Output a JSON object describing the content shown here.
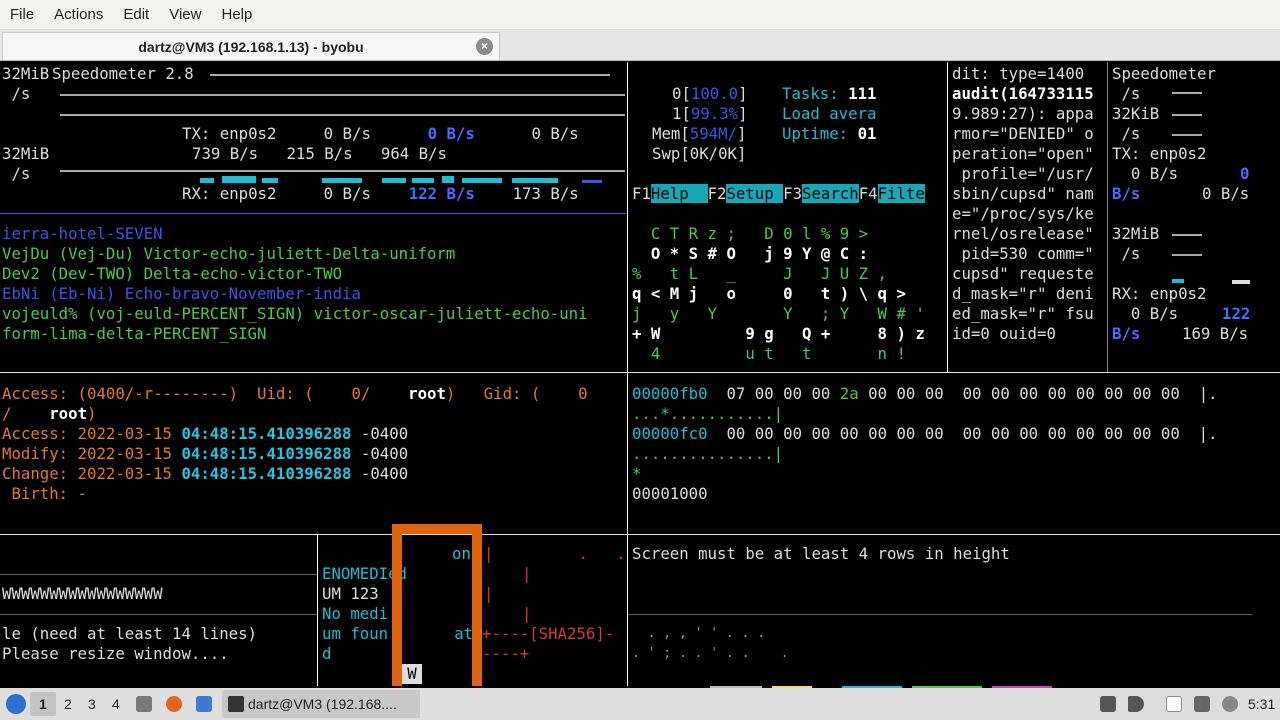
{
  "menubar": {
    "items": [
      "File",
      "Actions",
      "Edit",
      "View",
      "Help"
    ]
  },
  "tab": {
    "title": "dartz@VM3 (192.168.1.13) - byobu",
    "close": "×"
  },
  "speedometer": {
    "l1a": "32MiB",
    "l1b": "Speedometer 2.8",
    "l2": " /s",
    "tx": "TX: enp0s2     0 B/s      ",
    "tx_v": "0 B/s",
    "tx_t": "      0 B/s",
    "l5a": "32MiB",
    "l5b": "739 B/s   215 B/s   964 B/s",
    "l6": " /s",
    "rx": "RX: enp0s2     0 B/s    ",
    "rx_v": "122 B/s",
    "rx_t": "    173 B/s"
  },
  "htop": {
    "c0": "0[",
    "c0v": "100.0",
    "c0e": "]",
    "c1": "1[",
    "c1v": "99.3%",
    "c1e": "]",
    "mem": "Mem[",
    "memv": "594M/",
    "meme": "]",
    "swp": "Swp[0K/0K]",
    "tasks_l": "Tasks: ",
    "tasks_v": "111",
    "load": "Load avera",
    "up_l": "Uptime: ",
    "up_v": "01",
    "f1": "F1",
    "f1l": "Help  ",
    "f2": "F2",
    "f2l": "Setup ",
    "f3": "F3",
    "f3l": "Search",
    "f4": "F4",
    "f4l": "Filte"
  },
  "audit": {
    "a1": "dit: type=1400",
    "a2": "audit(164733115",
    "a3": "9.989:27): appa",
    "a4": "rmor=\"DENIED\" o",
    "a5": "peration=\"open\"",
    "a6": " profile=\"/usr/",
    "a7": "sbin/cupsd\" nam",
    "a8": "e=\"/proc/sys/ke",
    "a9": "rnel/osrelease\"",
    "a10": " pid=530 comm=\"",
    "a11": "cupsd\" requeste",
    "a12": "d_mask=\"r\" deni",
    "a13": "ed_mask=\"r\" fsu",
    "a14": "id=0 ouid=0"
  },
  "speed2": {
    "s1": "Speedometer",
    "s2": " /s",
    "s3": "32KiB",
    "s4": " /s",
    "s5": "TX: enp0s2",
    "s6a": "  0 B/s",
    "s6b": "0",
    "s7a": "B/s",
    "s7b": "0 B/s",
    "s8": "32MiB",
    "s9": " /s",
    "s10": "RX: enp0s2",
    "s11a": "  0 B/s",
    "s11b": "122",
    "s12a": "B/s",
    "s12b": "169 B/s"
  },
  "words": {
    "w1": "ierra-hotel-SEVEN",
    "w2": "VejDu (Vej-Du) Victor-echo-juliett-Delta-uniform",
    "w3": "Dev2 (Dev-TWO) Delta-echo-victor-TWO",
    "w4": "EbNi (Eb-Ni) Echo-bravo-November-india",
    "w5": "vojeuld% (voj-euld-PERCENT_SIGN) victor-oscar-juliett-echo-uni",
    "w6": "form-lima-delta-PERCENT_SIGN"
  },
  "matrix": {
    "m1": "  C T R z ;   D 0 l % 9 >",
    "m2": "  O * S # O   j 9 Y @ C :",
    "m3": "%   t L   _     J   J U Z ,",
    "m4": "q < M j   o     0   t ) \\ q >",
    "m5": "j   y   Y       Y   ; Y   W # '",
    "m6": "+ W         9 g   Q +     8 ) z",
    "m7": "  4         u t   t       n !"
  },
  "stat": {
    "p1a": "Access: (0400/-r--------)  Uid: (    0/    ",
    "p1b": "root",
    "p1c": ")   Gid: (    0",
    "p2a": "/    ",
    "p2b": "root",
    "p2c": ")",
    "access": "Access: 2022-03-15 ",
    "ts": "04:48:15.410396288",
    "tz": " -0400",
    "modify": "Modify: 2022-03-15 ",
    "change": "Change: 2022-03-15 ",
    "birth": " Birth: -"
  },
  "hex": {
    "h1a": "00000fb0",
    "h1b": "  07 00 00 00 ",
    "h1c": "2a",
    "h1d": " 00 00 00  00 00 00 00 00 00 00 00  |.",
    "h2": "...*...........|",
    "h3a": "00000fc0",
    "h3b": "  00 00 00 00 00 00 00 00  00 00 00 00 00 00 00 00  |.",
    "h4": "...............|",
    "h5": "*",
    "h6": "00001000"
  },
  "bottom": {
    "b1": "WWWWWWWWWWWWWWWWW",
    "b2": "le (need at least 14 lines)",
    "b3": "Please resize window....",
    "c1": "ENOMEDIed",
    "c2": "UM 123",
    "c3": "No medi",
    "c4": "um foun       at",
    "c5": "d",
    "c0": "on",
    "cursor": "W",
    "r1": "|         .   .",
    "r2": "|",
    "r3": "|",
    "r4": "|",
    "r5": "+----[SHA256]-",
    "r6": "----+",
    "screen": "Screen must be at least 4 rows in height",
    "dots1": "  . , , ' ' . . .",
    "dots2": ". ' ; . . ' . .    ."
  },
  "taskbar": {
    "ws": [
      "1",
      "2",
      "3",
      "4"
    ],
    "app": "dartz@VM3 (192.168....",
    "time": "5:31"
  }
}
